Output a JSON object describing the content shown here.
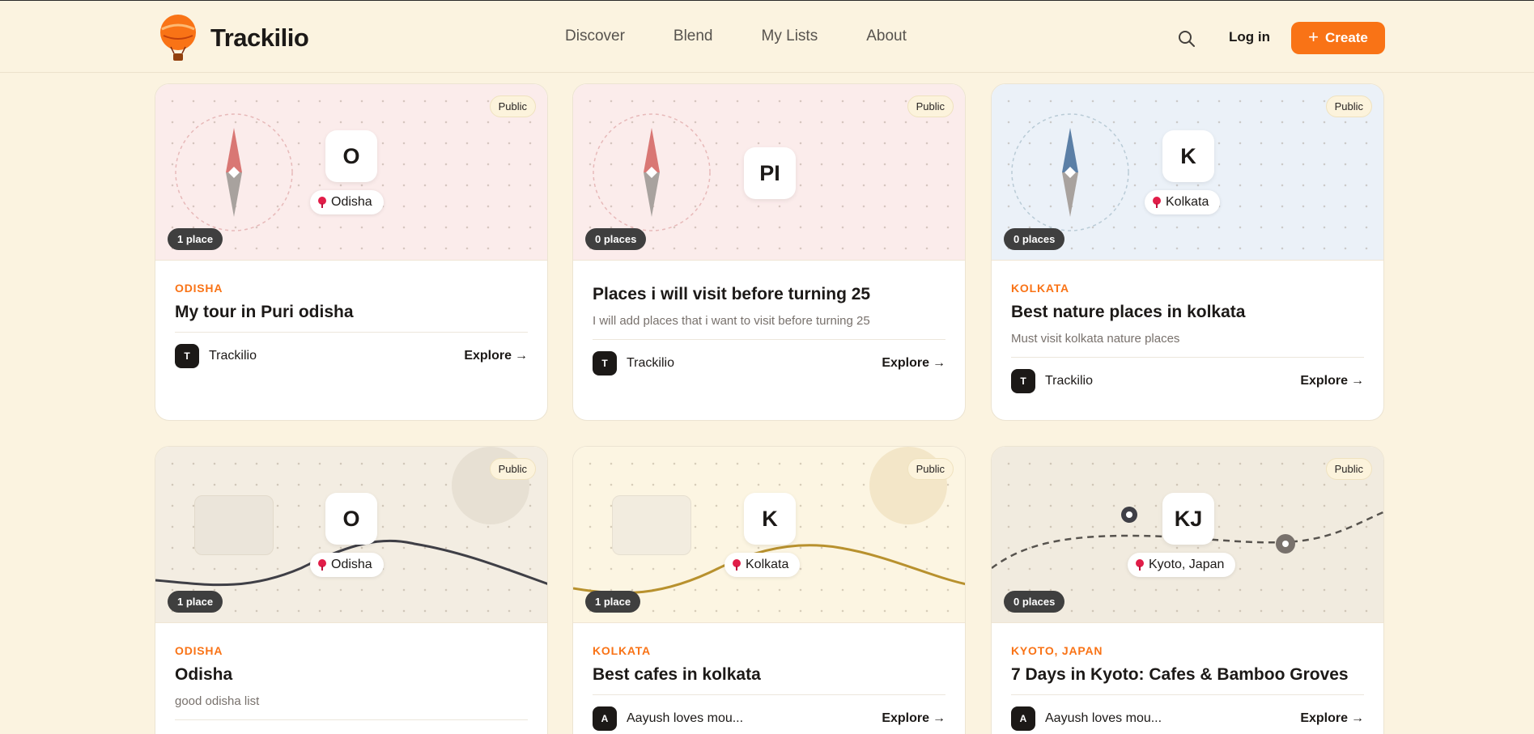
{
  "brand": {
    "name": "Trackilio"
  },
  "nav": [
    "Discover",
    "Blend",
    "My Lists",
    "About"
  ],
  "header": {
    "login": "Log in",
    "create": "Create"
  },
  "cards": [
    {
      "badge": "Public",
      "initial": "O",
      "location": "Odisha",
      "places": "1 place",
      "category": "ODISHA",
      "title": "My tour in Puri odisha",
      "description": "",
      "author": "Trackilio",
      "author_initial": "T",
      "explore": "Explore",
      "style": "compass-pink"
    },
    {
      "badge": "Public",
      "initial": "PI",
      "location": "",
      "places": "0 places",
      "category": "",
      "title": "Places i will visit before turning 25",
      "description": "I will add places that i want to visit before turning 25",
      "author": "Trackilio",
      "author_initial": "T",
      "explore": "Explore",
      "style": "compass-pink"
    },
    {
      "badge": "Public",
      "initial": "K",
      "location": "Kolkata",
      "places": "0 places",
      "category": "KOLKATA",
      "title": "Best nature places in kolkata",
      "description": "Must visit kolkata nature places",
      "author": "Trackilio",
      "author_initial": "T",
      "explore": "Explore",
      "style": "compass-blue"
    },
    {
      "badge": "Public",
      "initial": "O",
      "location": "Odisha",
      "places": "1 place",
      "category": "ODISHA",
      "title": "Odisha",
      "description": "good odisha list",
      "author": "",
      "author_initial": "",
      "explore": "",
      "style": "wave-dark"
    },
    {
      "badge": "Public",
      "initial": "K",
      "location": "Kolkata",
      "places": "1 place",
      "category": "KOLKATA",
      "title": "Best cafes in kolkata",
      "description": "",
      "author": "Aayush loves mou...",
      "author_initial": "A",
      "explore": "Explore",
      "style": "wave-gold"
    },
    {
      "badge": "Public",
      "initial": "KJ",
      "location": "Kyoto, Japan",
      "places": "0 places",
      "category": "KYOTO, JAPAN",
      "title": "7 Days in Kyoto: Cafes & Bamboo Groves",
      "description": "",
      "author": "Aayush loves mou...",
      "author_initial": "A",
      "explore": "Explore",
      "style": "route"
    }
  ],
  "colors": {
    "accent": "#f97316",
    "page_bg": "#fbf3e0",
    "pin": "#e11d48"
  },
  "icons": {
    "search": "search-icon",
    "create": "plus-icon",
    "explore": "arrow-right-icon",
    "location": "map-pin-icon"
  }
}
